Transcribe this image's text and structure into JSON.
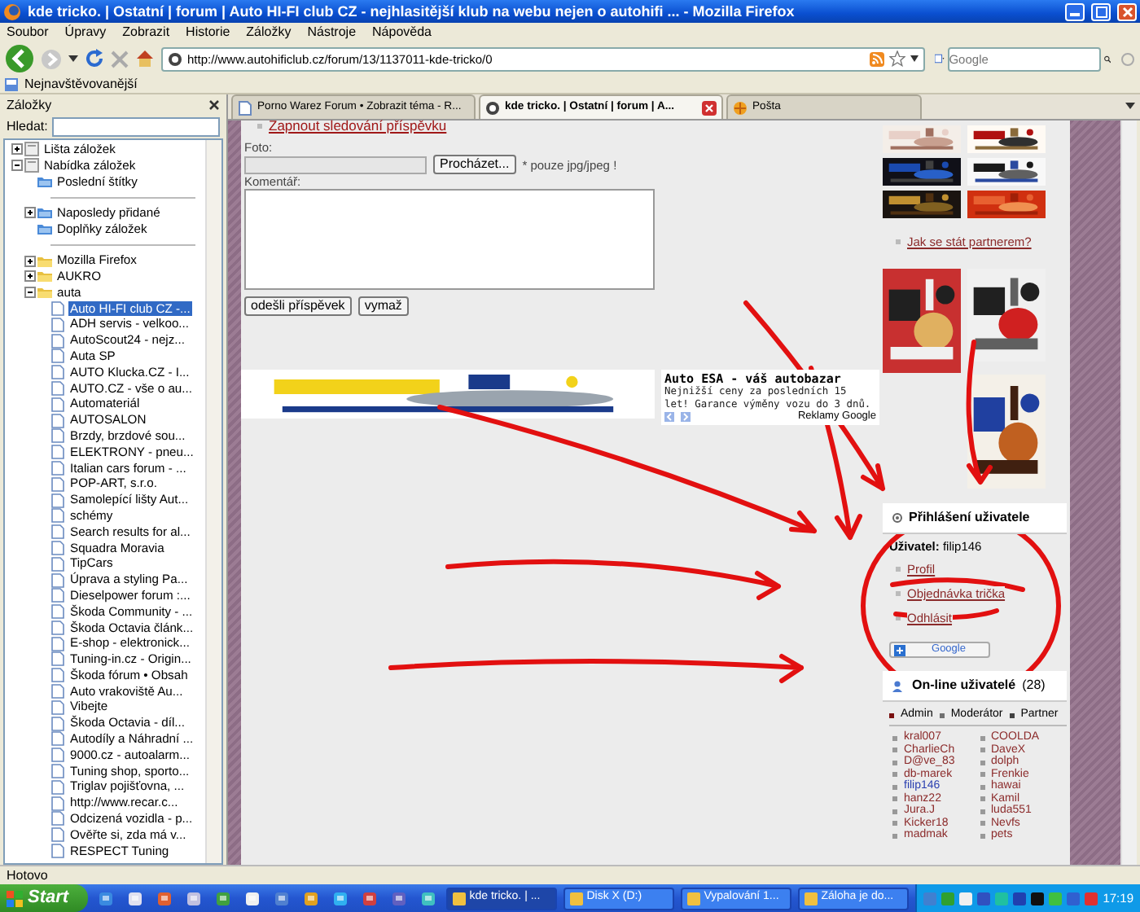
{
  "window": {
    "title": "kde tricko. | Ostatní | forum | Auto HI-FI club CZ - nejhlasitější klub na webu nejen o autohifi ... - Mozilla Firefox",
    "menu": [
      "Soubor",
      "Úpravy",
      "Zobrazit",
      "Historie",
      "Záložky",
      "Nástroje",
      "Nápověda"
    ]
  },
  "toolbar": {
    "url": "http://www.autohificlub.cz/forum/13/1137011-kde-tricko/0",
    "search_placeholder": "Google"
  },
  "bookmarks_toolbar": [
    "Nejnavštěvovanější"
  ],
  "sidebar": {
    "title": "Záložky",
    "search_label": "Hledat:",
    "tree": [
      {
        "kind": "root",
        "label": "Lišta záložek",
        "expanded": false
      },
      {
        "kind": "root",
        "label": "Nabídka záložek",
        "expanded": true,
        "children": [
          {
            "kind": "smart",
            "label": "Poslední štítky"
          },
          {
            "kind": "separator"
          },
          {
            "kind": "smart",
            "label": "Naposledy přidané",
            "expanded": false
          },
          {
            "kind": "smart",
            "label": "Doplňky záložek"
          },
          {
            "kind": "separator"
          },
          {
            "kind": "folder",
            "label": "Mozilla Firefox",
            "expanded": false
          },
          {
            "kind": "folder",
            "label": "AUKRO",
            "expanded": false
          },
          {
            "kind": "folder",
            "label": "auta",
            "expanded": true,
            "children": [
              {
                "kind": "bookmark",
                "label": "Auto HI-FI club CZ -...",
                "selected": true
              },
              {
                "kind": "bookmark",
                "label": "ADH servis - velkoo...",
                "selected": false
              },
              {
                "kind": "bookmark",
                "label": "AutoScout24 - nejz...",
                "selected": false
              },
              {
                "kind": "bookmark",
                "label": "Auta SP",
                "selected": false
              },
              {
                "kind": "bookmark",
                "label": "AUTO Klucka.CZ - I...",
                "selected": false
              },
              {
                "kind": "bookmark",
                "label": "AUTO.CZ - vše o au...",
                "selected": false
              },
              {
                "kind": "bookmark",
                "label": "Automateriál",
                "selected": false
              },
              {
                "kind": "bookmark",
                "label": "AUTOSALON",
                "selected": false
              },
              {
                "kind": "bookmark",
                "label": "Brzdy, brzdové sou...",
                "selected": false
              },
              {
                "kind": "bookmark",
                "label": "ELEKTRONY - pneu...",
                "selected": false
              },
              {
                "kind": "bookmark",
                "label": "Italian cars forum - ...",
                "selected": false
              },
              {
                "kind": "bookmark",
                "label": "POP-ART, s.r.o.",
                "selected": false
              },
              {
                "kind": "bookmark",
                "label": "Samolepící lišty Aut...",
                "selected": false
              },
              {
                "kind": "bookmark",
                "label": "schémy",
                "selected": false
              },
              {
                "kind": "bookmark",
                "label": "Search results for al...",
                "selected": false
              },
              {
                "kind": "bookmark",
                "label": "Squadra Moravia",
                "selected": false
              },
              {
                "kind": "bookmark",
                "label": "TipCars",
                "selected": false
              },
              {
                "kind": "bookmark",
                "label": "Úprava a styling Pa...",
                "selected": false
              },
              {
                "kind": "bookmark",
                "label": "Dieselpower forum :...",
                "selected": false
              },
              {
                "kind": "bookmark",
                "label": "Škoda Community - ...",
                "selected": false
              },
              {
                "kind": "bookmark",
                "label": "Škoda Octavia článk...",
                "selected": false
              },
              {
                "kind": "bookmark",
                "label": "E-shop - elektronick...",
                "selected": false
              },
              {
                "kind": "bookmark",
                "label": "Tuning-in.cz - Origin...",
                "selected": false
              },
              {
                "kind": "bookmark",
                "label": "Škoda fórum • Obsah",
                "selected": false
              },
              {
                "kind": "bookmark",
                "label": "Auto vrakoviště Au...",
                "selected": false
              },
              {
                "kind": "bookmark",
                "label": "Vibejte",
                "selected": false
              },
              {
                "kind": "bookmark",
                "label": "Škoda Octavia - díl...",
                "selected": false
              },
              {
                "kind": "bookmark",
                "label": "Autodíly a Náhradní ...",
                "selected": false
              },
              {
                "kind": "bookmark",
                "label": "9000.cz - autoalarm...",
                "selected": false
              },
              {
                "kind": "bookmark",
                "label": "Tuning shop, sporto...",
                "selected": false
              },
              {
                "kind": "bookmark",
                "label": "Triglav pojišťovna, ...",
                "selected": false
              },
              {
                "kind": "bookmark",
                "label": "http://www.recar.c...",
                "selected": false
              },
              {
                "kind": "bookmark",
                "label": "Odcizená vozidla - p...",
                "selected": false
              },
              {
                "kind": "bookmark",
                "label": "Ověřte si, zda má v...",
                "selected": false
              },
              {
                "kind": "bookmark",
                "label": "RESPECT Tuning",
                "selected": false
              }
            ]
          }
        ]
      }
    ]
  },
  "tabs": [
    {
      "label": "Porno Warez Forum • Zobrazit téma - R...",
      "selected": false
    },
    {
      "label": "kde tricko. | Ostatní | forum | A...",
      "selected": true
    },
    {
      "label": "Pošta",
      "selected": false
    }
  ],
  "page": {
    "watch_link": "Zapnout sledování příspěvku",
    "photo_label": "Foto:",
    "browse_button": "Procházet...",
    "photo_note": "* pouze jpg/jpeg !",
    "comment_label": "Komentář:",
    "buttons": [
      "odešli příspěvek",
      "vymaž"
    ],
    "ad": {
      "title": "Auto ESA - váš autobazar",
      "text": "Nejnižší ceny za posledních 15 let! Garance výměny vozu do 3 dnů.",
      "footer": "Reklamy Google"
    }
  },
  "right_column": {
    "partner_link": "Jak se stát partnerem?",
    "login": {
      "title": "Přihlášení uživatele",
      "user_label": "Uživatel:",
      "user": "filip146",
      "links": [
        "Profil",
        "Objednávka trička",
        "Odhlásit"
      ],
      "google_button": "Google"
    },
    "online": {
      "title": "On-line uživatelé",
      "count": "(28)",
      "legend": [
        {
          "label": "Admin",
          "color": "#7a1010"
        },
        {
          "label": "Moderátor",
          "color": "#707070"
        },
        {
          "label": "Partner",
          "color": "#404040"
        }
      ],
      "users": [
        {
          "name": "kral007",
          "color": "#8b2a2a"
        },
        {
          "name": "CharlieCh",
          "color": "#8b2a2a"
        },
        {
          "name": "D@ve_83",
          "color": "#8b2a2a"
        },
        {
          "name": "db-marek",
          "color": "#8b2a2a"
        },
        {
          "name": "filip146",
          "color": "#2a3fb0"
        },
        {
          "name": "hanz22",
          "color": "#8b2a2a"
        },
        {
          "name": "Jura.J",
          "color": "#8b2a2a"
        },
        {
          "name": "Kicker18",
          "color": "#8b2a2a"
        },
        {
          "name": "madmak",
          "color": "#8b2a2a"
        },
        {
          "name": "COOLDA",
          "color": "#8b2a2a"
        },
        {
          "name": "DaveX",
          "color": "#8b2a2a"
        },
        {
          "name": "dolph",
          "color": "#8b2a2a"
        },
        {
          "name": "Frenkie",
          "color": "#8b2a2a"
        },
        {
          "name": "hawai",
          "color": "#8b2a2a"
        },
        {
          "name": "Kamil",
          "color": "#8b2a2a"
        },
        {
          "name": "luda551",
          "color": "#8b2a2a"
        },
        {
          "name": "Nevfs",
          "color": "#8b2a2a"
        },
        {
          "name": "pets",
          "color": "#8b2a2a"
        }
      ]
    }
  },
  "status_bar": "Hotovo",
  "taskbar": {
    "start": "Start",
    "tasks": [
      {
        "label": "kde tricko. | ...",
        "selected": true
      },
      {
        "label": "Disk X (D:)",
        "selected": false
      },
      {
        "label": "Vypalování 1...",
        "selected": false
      },
      {
        "label": "Záloha je do...",
        "selected": false
      }
    ],
    "clock": "17:19"
  }
}
